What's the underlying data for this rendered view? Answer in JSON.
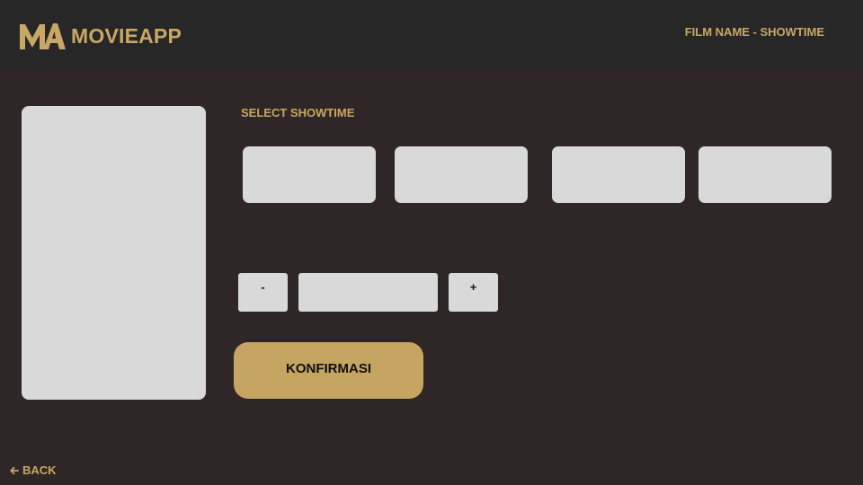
{
  "app": {
    "logo_mark": "MA",
    "name": "MOVIEAPP",
    "page_title": "FILM NAME - SHOWTIME"
  },
  "colors": {
    "header_bg": "#272727",
    "page_bg": "#2f2727",
    "accent": "#c9a764",
    "button_gold": "#c6a462",
    "placeholder_gray": "#d9d9d9"
  },
  "showtime": {
    "section_label": "SELECT SHOWTIME",
    "options": [
      "",
      "",
      "",
      ""
    ]
  },
  "quantity": {
    "decrement_label": "-",
    "value": "",
    "increment_label": "+"
  },
  "actions": {
    "confirm_label": "KONFIRMASI",
    "back_label": "BACK",
    "back_icon": "arrow-left-icon"
  }
}
